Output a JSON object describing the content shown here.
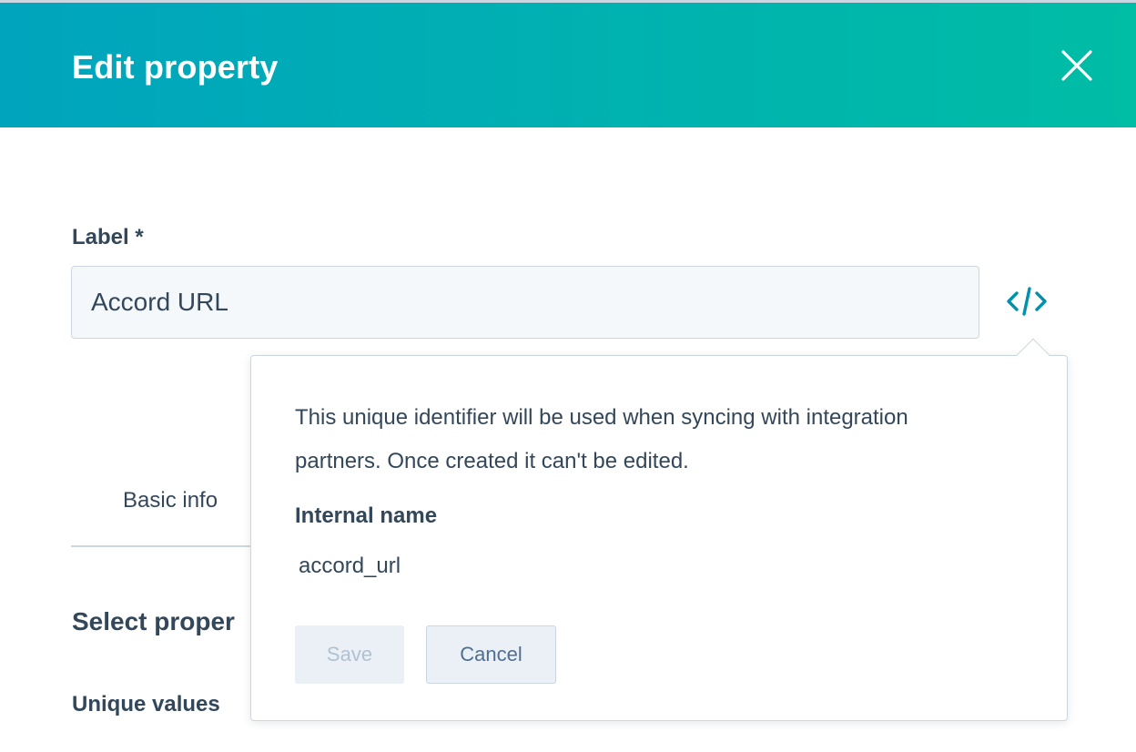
{
  "header": {
    "title": "Edit property",
    "close_icon": "close-icon"
  },
  "form": {
    "label_field": {
      "label": "Label *",
      "value": "Accord URL"
    },
    "code_icon": "code-icon"
  },
  "tabs": [
    {
      "label": "Basic info"
    }
  ],
  "sections": {
    "select_heading": "Select proper",
    "unique_values_label": "Unique values"
  },
  "popover": {
    "description": "This unique identifier will be used when syncing with integration partners. Once created it can't be edited.",
    "internal_name_label": "Internal name",
    "internal_name_value": "accord_url",
    "save_label": "Save",
    "cancel_label": "Cancel"
  },
  "colors": {
    "header_gradient_start": "#00a4bd",
    "header_gradient_end": "#00bda5",
    "text": "#33475b",
    "accent_icon": "#0091ae"
  }
}
